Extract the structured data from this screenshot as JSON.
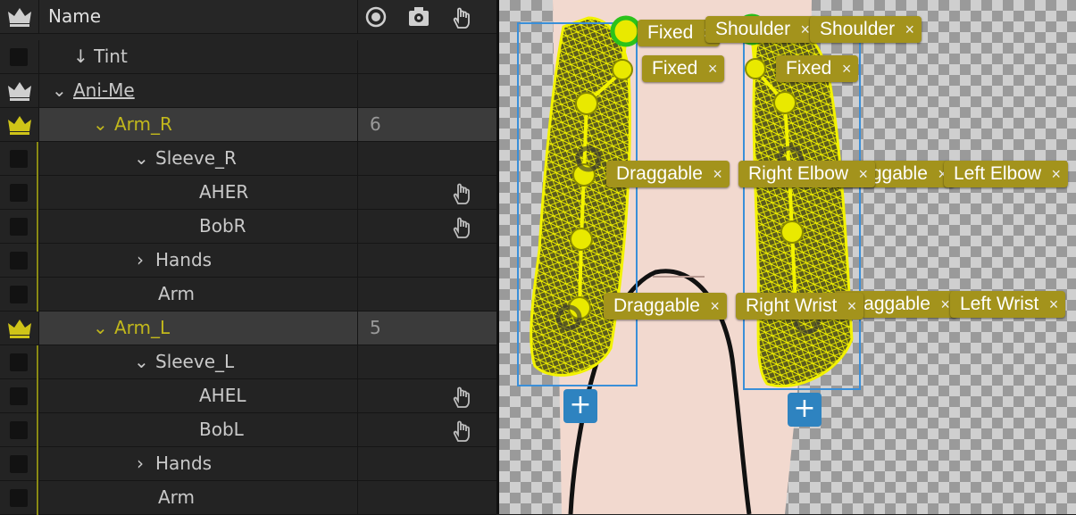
{
  "header": {
    "name_label": "Name"
  },
  "rows": [
    {
      "label": "Tint",
      "count": ""
    },
    {
      "label": "Ani-Me",
      "count": ""
    },
    {
      "label": "Arm_R",
      "count": "6"
    },
    {
      "label": "Sleeve_R",
      "count": ""
    },
    {
      "label": "AHER",
      "count": ""
    },
    {
      "label": "BobR",
      "count": ""
    },
    {
      "label": "Hands",
      "count": ""
    },
    {
      "label": "Arm",
      "count": ""
    },
    {
      "label": "Arm_L",
      "count": "5"
    },
    {
      "label": "Sleeve_L",
      "count": ""
    },
    {
      "label": "AHEL",
      "count": ""
    },
    {
      "label": "BobL",
      "count": ""
    },
    {
      "label": "Hands",
      "count": ""
    },
    {
      "label": "Arm",
      "count": ""
    }
  ],
  "canvas": {
    "tags": [
      {
        "label": "Fixed"
      },
      {
        "label": "Shoulder"
      },
      {
        "label": "Shoulder"
      },
      {
        "label": "Fixed"
      },
      {
        "label": "Fixed"
      },
      {
        "label": "Draggable"
      },
      {
        "label": "Draggable"
      },
      {
        "label": "Right Elbow"
      },
      {
        "label": "Left Elbow"
      },
      {
        "label": "Draggable"
      },
      {
        "label": "Draggable"
      },
      {
        "label": "Right Wrist"
      },
      {
        "label": "Left Wrist"
      }
    ],
    "add_symbol": "+",
    "close_symbol": "×",
    "colors": {
      "tag": "#a3931c",
      "mesh": "#f2f200",
      "handle_ring": "#2bc21b",
      "bbox": "#3a8fd8",
      "add_button": "#2e83c0",
      "skin": "#f2d9cf"
    }
  }
}
